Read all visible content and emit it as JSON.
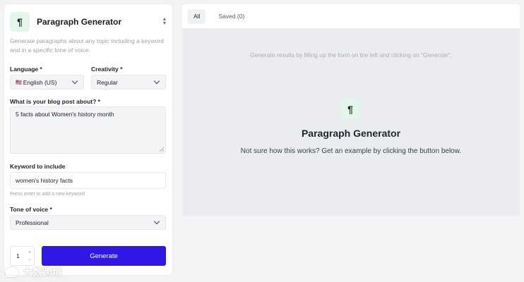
{
  "left": {
    "icon_glyph": "¶",
    "title": "Paragraph Generator",
    "description": "Generate paragraphs about any topic including a keyword and in a specific tone of voice.",
    "language": {
      "label": "Language *",
      "value": "English (US)",
      "flag": "🇺🇸"
    },
    "creativity": {
      "label": "Creativity *",
      "value": "Regular"
    },
    "topic": {
      "label": "What is your blog post about? *",
      "value": "5 facts about Women's history month"
    },
    "keyword": {
      "label": "Keyword to include",
      "value": "women's history facts",
      "hint": "Press enter to add a new keyword"
    },
    "tone": {
      "label": "Tone of voice *",
      "value": "Professional"
    },
    "quantity": {
      "value": "1",
      "plus": "+",
      "minus": "−"
    },
    "generate_label": "Generate"
  },
  "right": {
    "tabs": [
      {
        "label": "All",
        "active": true
      },
      {
        "label": "Saved (0)",
        "active": false
      }
    ],
    "results_hint": "Generate results by filling up the form on the left and clicking on \"Generate\".",
    "empty_icon_glyph": "¶",
    "empty_title": "Paragraph Generator",
    "empty_subtitle": "Not sure how this works? Get an example by clicking the button below."
  },
  "watermark": {
    "text": "大数跨境"
  },
  "colors": {
    "accent": "#2f17e6",
    "icon_bg": "#e3f6ea",
    "page_bg": "#f2f3f5",
    "results_bg": "#ebecf0"
  }
}
